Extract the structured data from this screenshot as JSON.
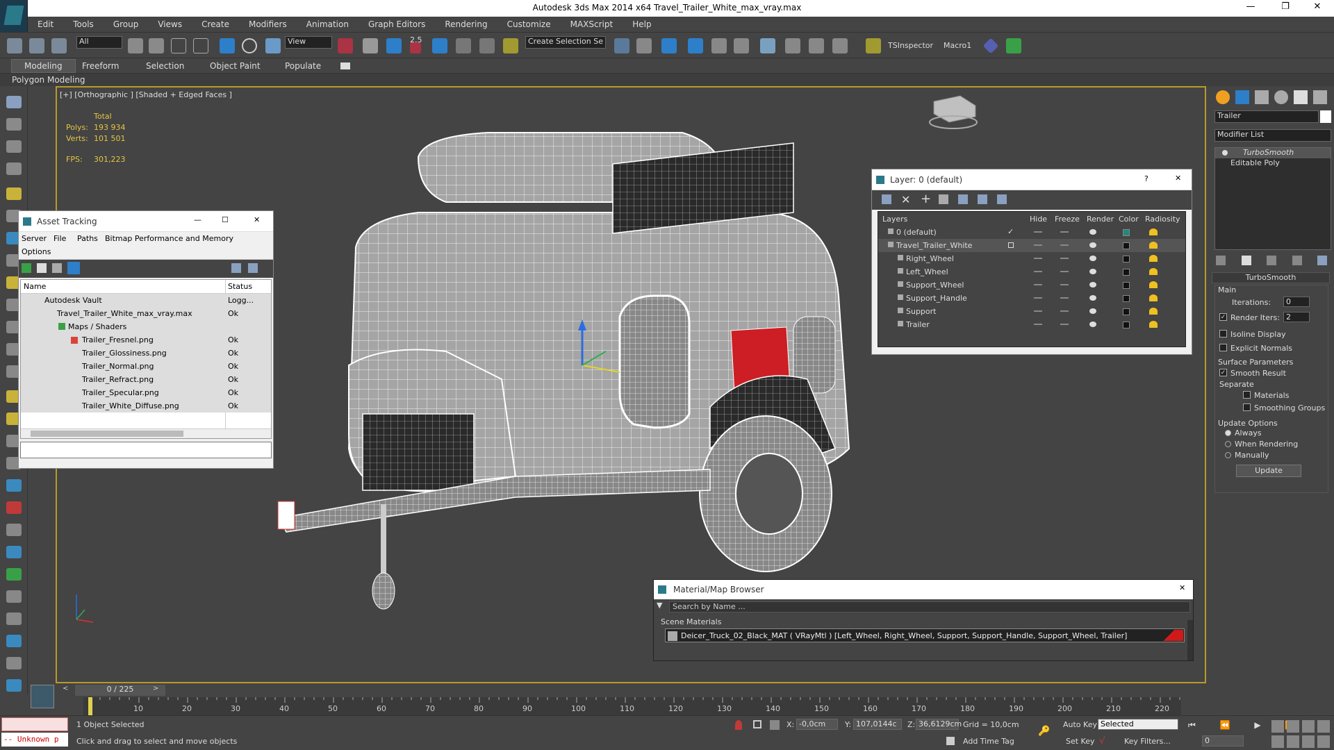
{
  "app_title": "Autodesk 3ds Max  2014 x64     Travel_Trailer_White_max_vray.max",
  "menu": [
    "Edit",
    "Tools",
    "Group",
    "Views",
    "Create",
    "Modifiers",
    "Animation",
    "Graph Editors",
    "Rendering",
    "Customize",
    "MAXScript",
    "Help"
  ],
  "toolbar": {
    "filter": "All",
    "ref_coord": "View",
    "snap_value": "2.5",
    "selection_set": "Create Selection Se",
    "tsinspector": "TSInspector",
    "macro": "Macro1"
  },
  "ribbon": {
    "tabs": [
      "Modeling",
      "Freeform",
      "Selection",
      "Object Paint",
      "Populate"
    ],
    "subtab": "Polygon Modeling"
  },
  "viewport": {
    "label": "[+] [Orthographic ] [Shaded + Edged Faces ]",
    "stats": {
      "total_label": "Total",
      "polys_label": "Polys:",
      "polys": "193 934",
      "verts_label": "Verts:",
      "verts": "101 501",
      "fps_label": "FPS:",
      "fps": "301,223"
    }
  },
  "asset_tracking": {
    "title": "Asset Tracking",
    "menu": [
      "Server",
      "File",
      "Paths",
      "Bitmap Performance and Memory",
      "Options"
    ],
    "columns": [
      "Name",
      "Status"
    ],
    "rows": [
      {
        "name": "Autodesk Vault",
        "status": "Logg..."
      },
      {
        "name": "Travel_Trailer_White_max_vray.max",
        "status": "Ok"
      },
      {
        "name": "Maps / Shaders",
        "status": ""
      },
      {
        "name": "Trailer_Fresnel.png",
        "status": "Ok"
      },
      {
        "name": "Trailer_Glossiness.png",
        "status": "Ok"
      },
      {
        "name": "Trailer_Normal.png",
        "status": "Ok"
      },
      {
        "name": "Trailer_Refract.png",
        "status": "Ok"
      },
      {
        "name": "Trailer_Specular.png",
        "status": "Ok"
      },
      {
        "name": "Trailer_White_Diffuse.png",
        "status": "Ok"
      }
    ]
  },
  "layers": {
    "title": "Layer: 0 (default)",
    "columns": [
      "Layers",
      "Hide",
      "Freeze",
      "Render",
      "Color",
      "Radiosity"
    ],
    "rows": [
      {
        "name": "0 (default)",
        "color": "#1e8a7a"
      },
      {
        "name": "Travel_Trailer_White",
        "color": "#111111"
      },
      {
        "name": "Right_Wheel",
        "color": "#111111"
      },
      {
        "name": "Left_Wheel",
        "color": "#111111"
      },
      {
        "name": "Support_Wheel",
        "color": "#111111"
      },
      {
        "name": "Support_Handle",
        "color": "#111111"
      },
      {
        "name": "Support",
        "color": "#111111"
      },
      {
        "name": "Trailer",
        "color": "#111111"
      }
    ]
  },
  "material_browser": {
    "title": "Material/Map Browser",
    "search_placeholder": "Search by Name ...",
    "section": "Scene Materials",
    "item": "Deicer_Truck_02_Black_MAT  ( VRayMtl )  [Left_Wheel, Right_Wheel, Support, Support_Handle, Support_Wheel, Trailer]"
  },
  "command_panel": {
    "object_name": "Trailer",
    "modifier_list": "Modifier List",
    "stack": [
      "TurboSmooth",
      "Editable Poly"
    ],
    "turbosmooth": {
      "title": "TurboSmooth",
      "main": "Main",
      "iterations_label": "Iterations:",
      "iterations": "0",
      "render_iters_label": "Render Iters:",
      "render_iters": "2",
      "isoline": "Isoline Display",
      "explicit": "Explicit Normals",
      "surface": "Surface Parameters",
      "smooth_result": "Smooth Result",
      "separate": "Separate",
      "materials": "Materials",
      "smoothing_groups": "Smoothing Groups",
      "update_options": "Update Options",
      "always": "Always",
      "when_rendering": "When Rendering",
      "manually": "Manually",
      "update_btn": "Update"
    }
  },
  "timeline": {
    "frame": "0 / 225",
    "ticks": [
      "10",
      "20",
      "30",
      "40",
      "50",
      "60",
      "70",
      "80",
      "90",
      "100",
      "110",
      "120",
      "130",
      "140",
      "150",
      "160",
      "170",
      "180",
      "190",
      "200",
      "210",
      "220"
    ]
  },
  "status": {
    "maxscript": "-- Unknown p",
    "selected": "1 Object Selected",
    "prompt": "Click and drag to select and move objects",
    "x_label": "X:",
    "x": "-0,0cm",
    "y_label": "Y:",
    "y": "107,0144c",
    "z_label": "Z:",
    "z": "36,6129cm",
    "grid": "Grid = 10,0cm",
    "add_time_tag": "Add Time Tag",
    "auto_key": "Auto Key",
    "selected_dd": "Selected",
    "set_key": "Set Key",
    "key_filters": "Key Filters...",
    "frame_field": "0"
  }
}
